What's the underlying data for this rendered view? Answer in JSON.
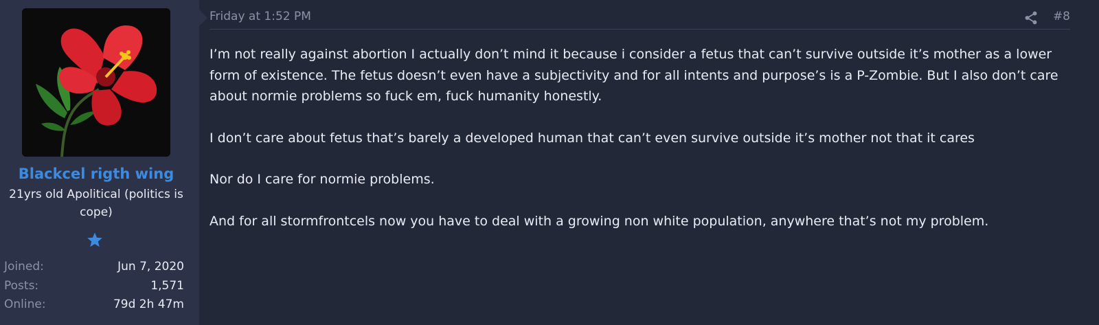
{
  "user": {
    "username": "Blackcel rigth wing",
    "title": "21yrs old Apolitical (politics is cope)",
    "badge_icon": "star-icon",
    "stats": [
      {
        "label": "Joined:",
        "value": "Jun 7, 2020"
      },
      {
        "label": "Posts:",
        "value": "1,571"
      },
      {
        "label": "Online:",
        "value": "79d 2h 47m"
      }
    ]
  },
  "post": {
    "date": "Friday at 1:52 PM",
    "number": "#8",
    "share_icon": "share-icon",
    "paragraphs": [
      "I’m not really against abortion I actually don’t mind it because i consider a fetus that can’t survive outside it’s mother as a lower form of existence. The fetus doesn’t even have a subjectivity and for all intents and purpose’s is a P-Zombie. But I also don’t care about normie problems so fuck em, fuck humanity honestly.",
      "I don’t care about fetus that’s barely a developed human that can’t even survive outside it’s mother not that it cares",
      "Nor do I care for normie problems.",
      "And for all stormfrontcels now you have to deal with a growing non white population, anywhere that’s not my problem."
    ]
  },
  "colors": {
    "background": "#232839",
    "user_pane": "#2c3349",
    "username": "#3d8be0",
    "text": "#e9ecf4",
    "muted": "#8b92a6"
  }
}
